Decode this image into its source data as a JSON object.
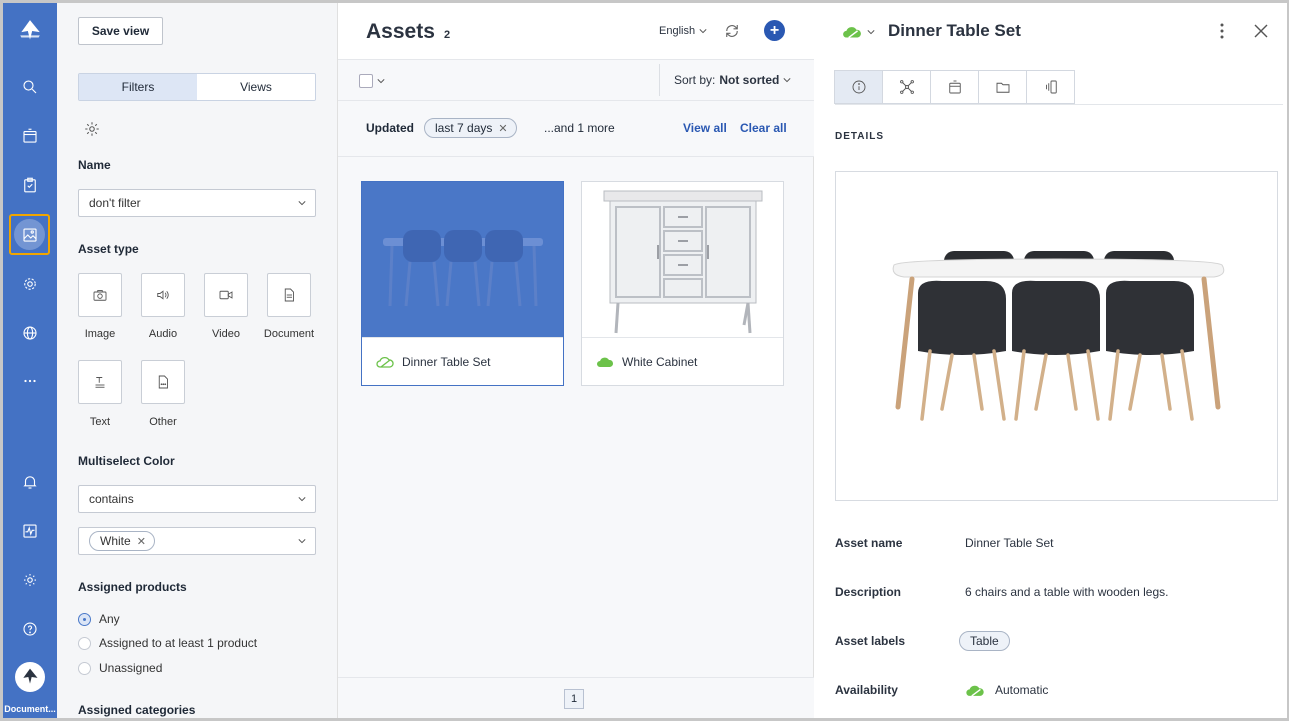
{
  "rail": {
    "doc_label": "Document..."
  },
  "filters": {
    "save_view": "Save view",
    "tabs": [
      "Filters",
      "Views"
    ],
    "name_label": "Name",
    "name_select": "don't filter",
    "asset_type_label": "Asset type",
    "asset_types": [
      "Image",
      "Audio",
      "Video",
      "Document",
      "Text",
      "Other"
    ],
    "multiselect_label": "Multiselect Color",
    "multiselect_op": "contains",
    "multiselect_value": "White",
    "assigned_products_label": "Assigned products",
    "assigned_options": [
      "Any",
      "Assigned to at least 1 product",
      "Unassigned"
    ],
    "assigned_categories_label": "Assigned categories"
  },
  "assets": {
    "title": "Assets",
    "count": "2",
    "language": "English",
    "sort_prefix": "Sort by:",
    "sort_value": "Not sorted",
    "filter_label": "Updated",
    "filter_chip": "last 7 days",
    "more": "...and 1 more",
    "view_all": "View all",
    "clear_all": "Clear all",
    "cards": [
      {
        "name": "Dinner Table Set"
      },
      {
        "name": "White Cabinet"
      }
    ],
    "page": "1"
  },
  "detail": {
    "title": "Dinner Table Set",
    "section": "DETAILS",
    "rows": {
      "asset_name_label": "Asset name",
      "asset_name_value": "Dinner Table Set",
      "description_label": "Description",
      "description_value": "6 chairs and a table with wooden legs.",
      "labels_label": "Asset labels",
      "labels_value": "Table",
      "availability_label": "Availability",
      "availability_value": "Automatic"
    }
  },
  "colors": {
    "rail": "#4472c4",
    "accent": "#2a58b2",
    "highlight": "#f0a500",
    "cloud": "#6cc24a"
  }
}
